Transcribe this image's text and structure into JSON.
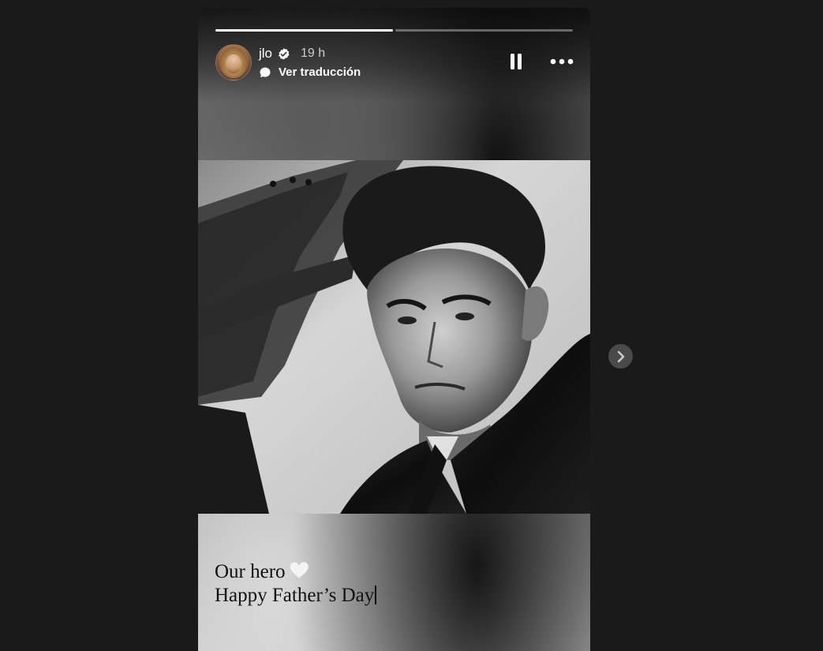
{
  "story": {
    "progress": [
      {
        "fill": 1.0
      },
      {
        "fill": 0.0
      }
    ],
    "user": {
      "username": "jlo",
      "verified": true,
      "time": "19 h",
      "avatar_icon": "profile-avatar"
    },
    "translate_label": "Ver traducción",
    "controls": {
      "pause_icon": "pause-icon",
      "more_icon": "more-options-icon"
    },
    "caption": {
      "line1": "Our hero",
      "line2": "Happy Father’s Day"
    }
  },
  "navigation": {
    "next_icon": "chevron-right-icon"
  },
  "colors": {
    "background": "#1a1a1a",
    "verified_badge": "#ffffff",
    "progress_fill": "#ffffff",
    "next_button": "#4a4a4a"
  }
}
